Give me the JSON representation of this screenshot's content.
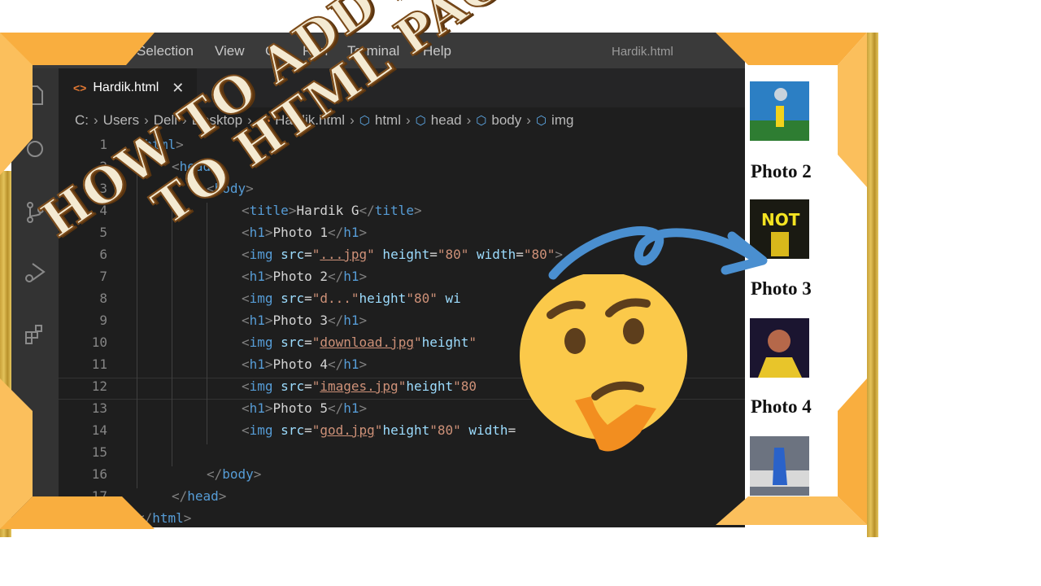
{
  "window": {
    "menu": [
      "Selection",
      "View",
      "Go",
      "Run",
      "Terminal",
      "Help"
    ],
    "title": "Hardik.html"
  },
  "activity_bar": [
    "explorer-icon",
    "search-icon",
    "source-control-icon",
    "run-debug-icon",
    "extensions-icon"
  ],
  "tab": {
    "label": "Hardik.html",
    "close": "✕",
    "icon": "html-file-icon"
  },
  "breadcrumb": {
    "items": [
      "C:",
      "Users",
      "Dell",
      "Desktop",
      "Hardik.html",
      "html",
      "head",
      "body",
      "img"
    ],
    "separator": "›"
  },
  "code": {
    "lines": [
      {
        "n": "1",
        "text": "<html>"
      },
      {
        "n": "2",
        "text": "<head>"
      },
      {
        "n": "3",
        "text": "<body>"
      },
      {
        "n": "4",
        "text": "<title>Hardik G</title>"
      },
      {
        "n": "5",
        "text": "<h1>Photo 1</h1>"
      },
      {
        "n": "6",
        "text": "<img src=\"...jpg\" height=\"80\" width=\"80\">"
      },
      {
        "n": "7",
        "text": "<h1>Photo 2</h1>"
      },
      {
        "n": "8",
        "text": "<img src=\"d...\"height=\"80\" wi"
      },
      {
        "n": "9",
        "text": "<h1>Photo 3</h1>"
      },
      {
        "n": "10",
        "text": "<img src=\"download.jpg\"height=\""
      },
      {
        "n": "11",
        "text": "<h1>Photo 4</h1>"
      },
      {
        "n": "12",
        "text": "<img src=\"images.jpg\"height=\"80"
      },
      {
        "n": "13",
        "text": "<h1>Photo 5</h1>"
      },
      {
        "n": "14",
        "text": "<img src=\"god.jpg\"height=\"80\" width="
      },
      {
        "n": "15",
        "text": ""
      },
      {
        "n": "16",
        "text": "</body>"
      },
      {
        "n": "17",
        "text": "</head>"
      },
      {
        "n": "",
        "text": "</html>"
      }
    ]
  },
  "preview": {
    "headings": [
      "Photo 2",
      "Photo 3",
      "Photo 4"
    ],
    "images": [
      "photo-1-thumbnail",
      "photo-2-thumbnail",
      "photo-3-thumbnail",
      "photo-4-thumbnail"
    ]
  },
  "headline": {
    "line1": "HOW TO ADD PHOTOS",
    "line2": "TO HTML PAGE ?"
  },
  "colors": {
    "accent_orange": "#f9ae3f",
    "editor_bg": "#1e1e1e",
    "arrow_blue": "#4a8fd0",
    "emoji_yellow": "#fbc94a"
  }
}
